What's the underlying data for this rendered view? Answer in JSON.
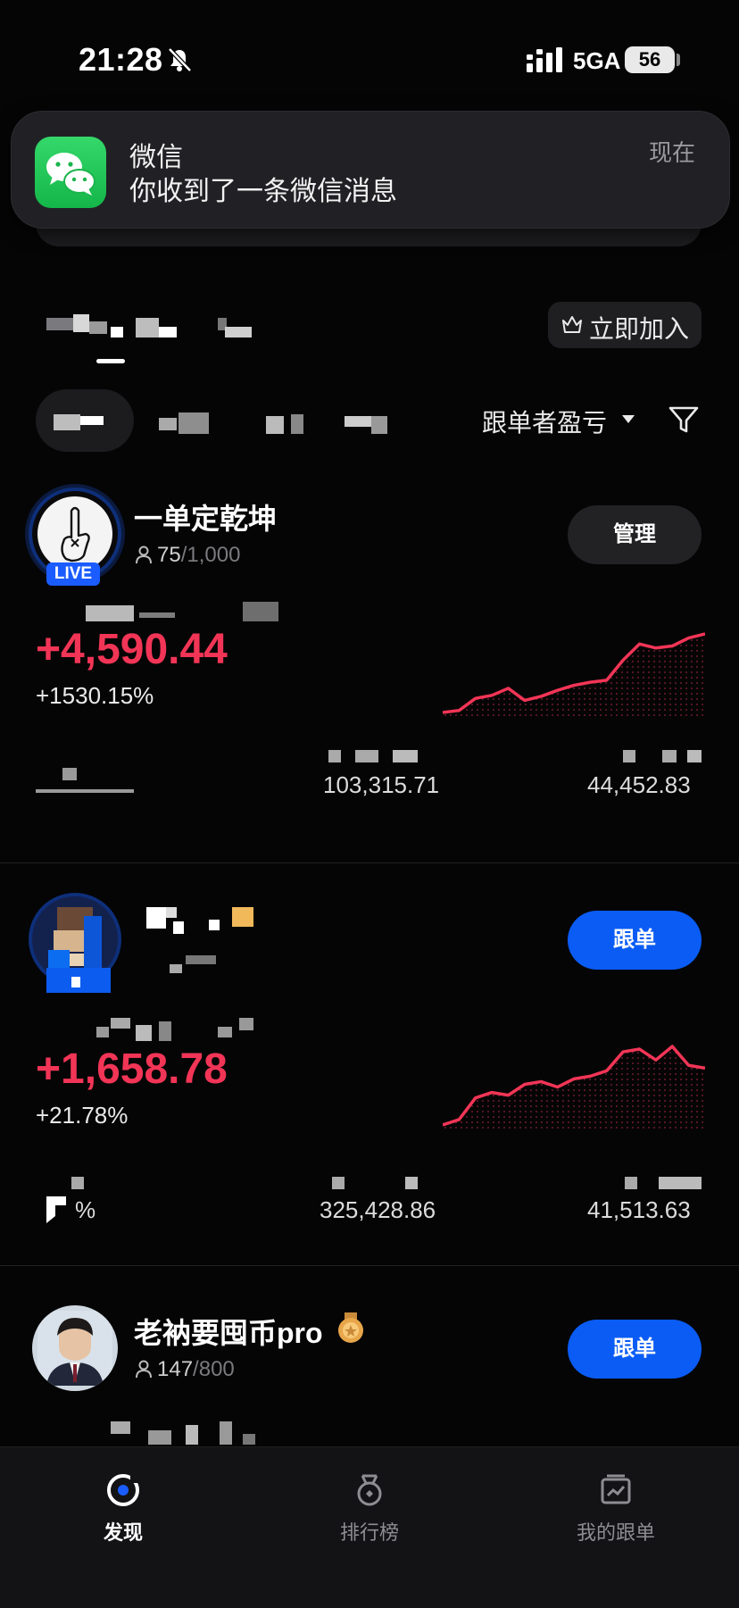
{
  "status_bar": {
    "time": "21:28",
    "network": "5GA",
    "battery": "56"
  },
  "notification": {
    "app": "微信",
    "body": "你收到了一条微信消息",
    "time": "现在"
  },
  "header": {
    "join_label": "立即加入",
    "sort_label": "跟单者盈亏"
  },
  "traders": [
    {
      "name": "一单定乾坤",
      "followers": "75",
      "capacity": "/1,000",
      "live_badge": "LIVE",
      "action": "管理",
      "pnl": "+4,590.44",
      "pnl_pct": "+1530.15%",
      "stat_2": "103,315.71",
      "stat_3": "44,452.83",
      "sparkline": [
        8,
        10,
        22,
        25,
        32,
        20,
        24,
        30,
        35,
        38,
        40,
        60,
        76,
        72,
        74,
        82,
        86
      ]
    },
    {
      "name": "",
      "action": "跟单",
      "pnl": "+1,658.78",
      "pnl_pct": "+21.78%",
      "stat_1": "%",
      "stat_2": "325,428.86",
      "stat_3": "41,513.63",
      "sparkline": [
        10,
        14,
        30,
        34,
        32,
        40,
        42,
        38,
        44,
        46,
        50,
        64,
        66,
        58,
        68,
        54,
        52
      ]
    },
    {
      "name": "老衲要囤币pro",
      "followers": "147",
      "capacity": "/800",
      "action": "跟单"
    }
  ],
  "bottom_nav": [
    {
      "label": "发现",
      "icon": "discover-icon",
      "active": true
    },
    {
      "label": "排行榜",
      "icon": "medal-icon",
      "active": false
    },
    {
      "label": "我的跟单",
      "icon": "portfolio-chart-icon",
      "active": false
    }
  ],
  "colors": {
    "profit_red": "#f23556",
    "primary_blue": "#0a5cf4",
    "wechat_green": "#22c55e"
  }
}
